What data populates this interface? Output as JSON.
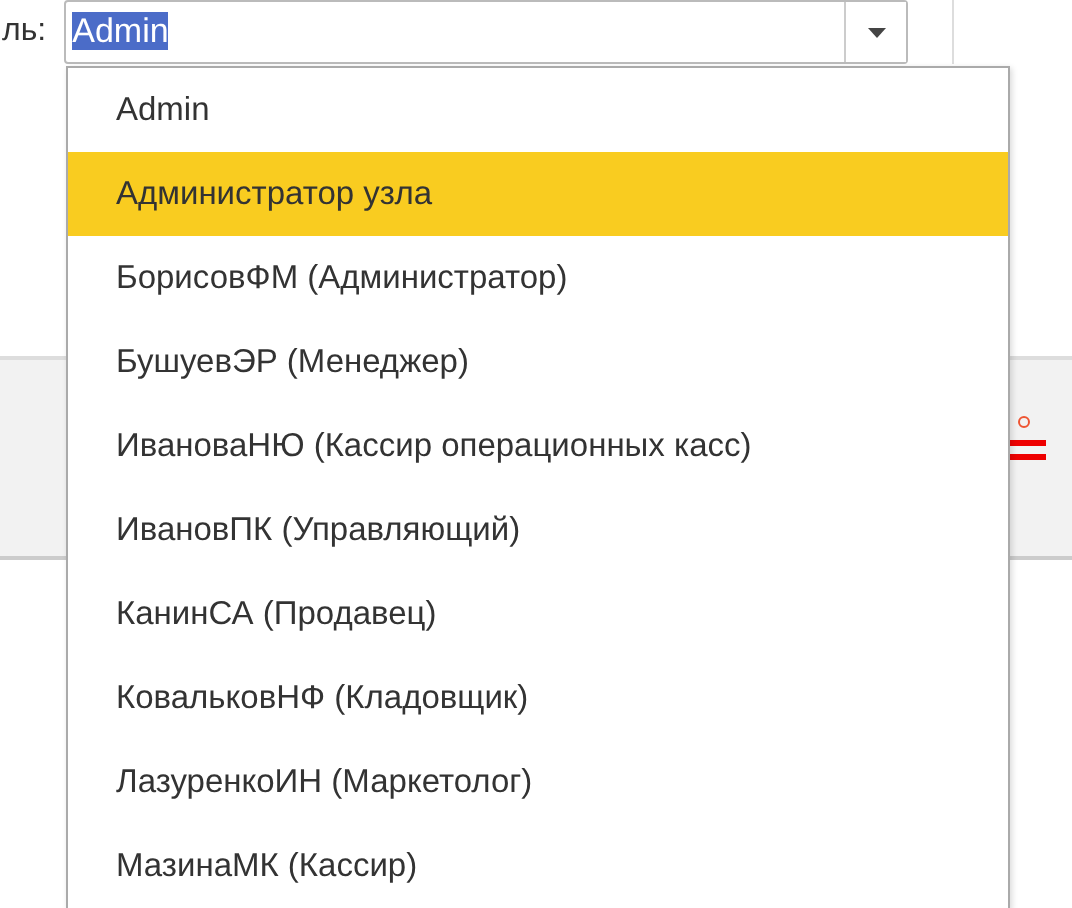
{
  "field": {
    "label": "ль:",
    "value": "Admin",
    "value_selected": true
  },
  "dropdown": {
    "items": [
      {
        "label": "Admin",
        "selected": false
      },
      {
        "label": "Администратор узла",
        "selected": true
      },
      {
        "label": "БорисовФМ (Администратор)",
        "selected": false
      },
      {
        "label": "БушуевЭР (Менеджер)",
        "selected": false
      },
      {
        "label": "ИвановаНЮ (Кассир операционных касс)",
        "selected": false
      },
      {
        "label": "ИвановПК (Управляющий)",
        "selected": false
      },
      {
        "label": "КанинСА (Продавец)",
        "selected": false
      },
      {
        "label": "КовальковНФ (Кладовщик)",
        "selected": false
      },
      {
        "label": "ЛазуренкоИН (Маркетолог)",
        "selected": false
      },
      {
        "label": "МазинаМК (Кассир)",
        "selected": false
      }
    ]
  }
}
